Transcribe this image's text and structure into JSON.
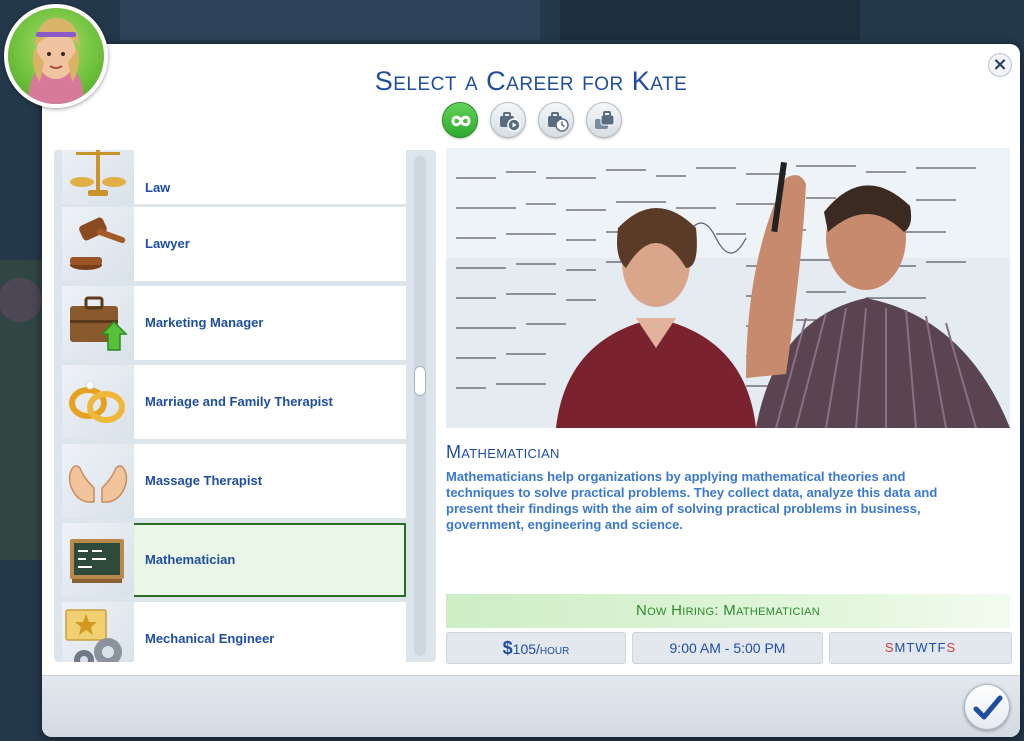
{
  "dialog": {
    "title": "Select a Career for Kate",
    "close_glyph": "×"
  },
  "filters": [
    {
      "icon": "infinity-icon",
      "active": true
    },
    {
      "icon": "briefcase-play-icon",
      "active": false
    },
    {
      "icon": "briefcase-clock-icon",
      "active": false
    },
    {
      "icon": "briefcase-stack-icon",
      "active": false
    }
  ],
  "careers": [
    {
      "label": "Law",
      "icon": "scales-icon"
    },
    {
      "label": "Lawyer",
      "icon": "gavel-icon"
    },
    {
      "label": "Marketing Manager",
      "icon": "briefcase-arrow-icon"
    },
    {
      "label": "Marriage and Family Therapist",
      "icon": "wedding-rings-icon"
    },
    {
      "label": "Massage Therapist",
      "icon": "hands-icon"
    },
    {
      "label": "Mathematician",
      "icon": "chalkboard-icon",
      "selected": true
    },
    {
      "label": "Mechanical Engineer",
      "icon": "gears-star-icon"
    }
  ],
  "detail": {
    "name": "Mathematician",
    "description": "Mathematicians help organizations by applying mathematical theories and techniques to solve practical problems. They collect data, analyze this data and present their findings with the aim of solving practical problems in business, government, engineering and science.",
    "hiring": "Now Hiring: Mathematician",
    "pay_symbol": "$",
    "pay_value": "105/hour",
    "hours": "9:00 AM - 5:00 PM",
    "days": [
      {
        "letter": "S",
        "off": true
      },
      {
        "letter": "M",
        "off": false
      },
      {
        "letter": "T",
        "off": false
      },
      {
        "letter": "W",
        "off": false
      },
      {
        "letter": "T",
        "off": false
      },
      {
        "letter": "F",
        "off": false
      },
      {
        "letter": "S",
        "off": true
      }
    ]
  },
  "colors": {
    "title_blue": "#1f4ea1",
    "desc_blue": "#3a78cf",
    "hiring_green": "#2e8a2e",
    "weekend_red": "#d23c3c",
    "selected_border": "#2a6e2a"
  }
}
